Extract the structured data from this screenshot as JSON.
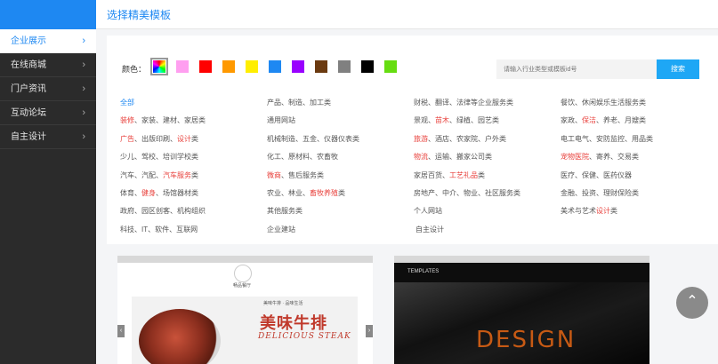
{
  "header": {
    "title": "选择精美模板"
  },
  "sidebar": {
    "items": [
      {
        "label": "企业展示",
        "active": true
      },
      {
        "label": "在线商城",
        "active": false
      },
      {
        "label": "门户资讯",
        "active": false
      },
      {
        "label": "互动论坛",
        "active": false
      },
      {
        "label": "自主设计",
        "active": false
      }
    ],
    "arrow": "›"
  },
  "filter": {
    "color_label": "颜色：",
    "colors": [
      "multicolor",
      "#ff9ff0",
      "#ff0000",
      "#ff9900",
      "#ffee00",
      "#1e88f2",
      "#9900ff",
      "#6b3a10",
      "#808080",
      "#000000",
      "#66dd11"
    ],
    "search_placeholder": "请输入行业类型或模板id号",
    "search_button": "搜索"
  },
  "categories": [
    [
      {
        "parts": [
          {
            "t": "全部",
            "hl": false
          }
        ]
      },
      {
        "parts": [
          {
            "t": "装修",
            "hl": true
          },
          {
            "t": "、家装、建材、家居类",
            "hl": false
          }
        ]
      },
      {
        "parts": [
          {
            "t": "广告",
            "hl": true
          },
          {
            "t": "、出版印刷、",
            "hl": false
          },
          {
            "t": "设计",
            "hl": true
          },
          {
            "t": "类",
            "hl": false
          }
        ]
      },
      {
        "parts": [
          {
            "t": "少儿、驾校、培训学校类",
            "hl": false
          }
        ]
      },
      {
        "parts": [
          {
            "t": "汽车、汽配、",
            "hl": false
          },
          {
            "t": "汽车服务",
            "hl": true
          },
          {
            "t": "类",
            "hl": false
          }
        ]
      },
      {
        "parts": [
          {
            "t": "体育、",
            "hl": false
          },
          {
            "t": "健身",
            "hl": true
          },
          {
            "t": "、场馆器材类",
            "hl": false
          }
        ]
      },
      {
        "parts": [
          {
            "t": "政府、园区创客、机构组织",
            "hl": false
          }
        ]
      },
      {
        "parts": [
          {
            "t": "科技、IT、软件、互联网",
            "hl": false
          }
        ]
      }
    ],
    [
      {
        "parts": [
          {
            "t": "产品、制造、加工类",
            "hl": false
          }
        ]
      },
      {
        "parts": [
          {
            "t": "通用网站",
            "hl": false
          }
        ]
      },
      {
        "parts": [
          {
            "t": "机械制造、五金、仪器仪表类",
            "hl": false
          }
        ]
      },
      {
        "parts": [
          {
            "t": "化工、原材料、农畜牧",
            "hl": false
          }
        ]
      },
      {
        "parts": [
          {
            "t": "微商",
            "hl": true
          },
          {
            "t": "、售后服务类",
            "hl": false
          }
        ]
      },
      {
        "parts": [
          {
            "t": "农业、林业、",
            "hl": false
          },
          {
            "t": "畜牧养殖",
            "hl": true
          },
          {
            "t": "类",
            "hl": false
          }
        ]
      },
      {
        "parts": [
          {
            "t": "其他服务类",
            "hl": false
          }
        ]
      },
      {
        "parts": [
          {
            "t": "企业建站",
            "hl": false
          }
        ]
      }
    ],
    [
      {
        "parts": [
          {
            "t": "财税、翻译、法律等企业服务类",
            "hl": false
          }
        ]
      },
      {
        "parts": [
          {
            "t": "景观、",
            "hl": false
          },
          {
            "t": "苗木",
            "hl": true
          },
          {
            "t": "、绿植、园艺类",
            "hl": false
          }
        ]
      },
      {
        "parts": [
          {
            "t": "旅游",
            "hl": true
          },
          {
            "t": "、酒店、农家院、户外类",
            "hl": false
          }
        ]
      },
      {
        "parts": [
          {
            "t": "物流",
            "hl": true
          },
          {
            "t": "、运输、搬家公司类",
            "hl": false
          }
        ]
      },
      {
        "parts": [
          {
            "t": "家居百货、",
            "hl": false
          },
          {
            "t": "工艺礼品",
            "hl": true
          },
          {
            "t": "类",
            "hl": false
          }
        ]
      },
      {
        "parts": [
          {
            "t": "房地产、中介、物业、社区服务类",
            "hl": false
          }
        ]
      },
      {
        "parts": [
          {
            "t": "个人网站",
            "hl": false
          }
        ]
      },
      {
        "parts": [
          {
            "t": "自主设计",
            "hl": false
          }
        ]
      }
    ],
    [
      {
        "parts": [
          {
            "t": "餐饮、休闲娱乐生活服务类",
            "hl": false
          }
        ]
      },
      {
        "parts": [
          {
            "t": "家政、",
            "hl": false
          },
          {
            "t": "保洁",
            "hl": true
          },
          {
            "t": "、养老、月嫂类",
            "hl": false
          }
        ]
      },
      {
        "parts": [
          {
            "t": "电工电气、安防监控、用品类",
            "hl": false
          }
        ]
      },
      {
        "parts": [
          {
            "t": "宠物医院",
            "hl": true
          },
          {
            "t": "、寄养、交易类",
            "hl": false
          }
        ]
      },
      {
        "parts": [
          {
            "t": "医疗、保健、医药仪器",
            "hl": false
          }
        ]
      },
      {
        "parts": [
          {
            "t": "金融、投资、理财保险类",
            "hl": false
          }
        ]
      },
      {
        "parts": [
          {
            "t": "美术与艺术",
            "hl": false
          },
          {
            "t": "设计",
            "hl": true
          },
          {
            "t": "类",
            "hl": false
          }
        ]
      }
    ]
  ],
  "templates": {
    "t1": {
      "brand": "畅品餐厅",
      "subtitle": "美味牛排 · 品味生活",
      "big": "美味牛排",
      "eng": "DELICIOUS STEAK"
    },
    "t2": {
      "logo": "TEMPLATES",
      "design": "DESIGN"
    }
  },
  "scroll_top_icon": "chevron-up-icon"
}
